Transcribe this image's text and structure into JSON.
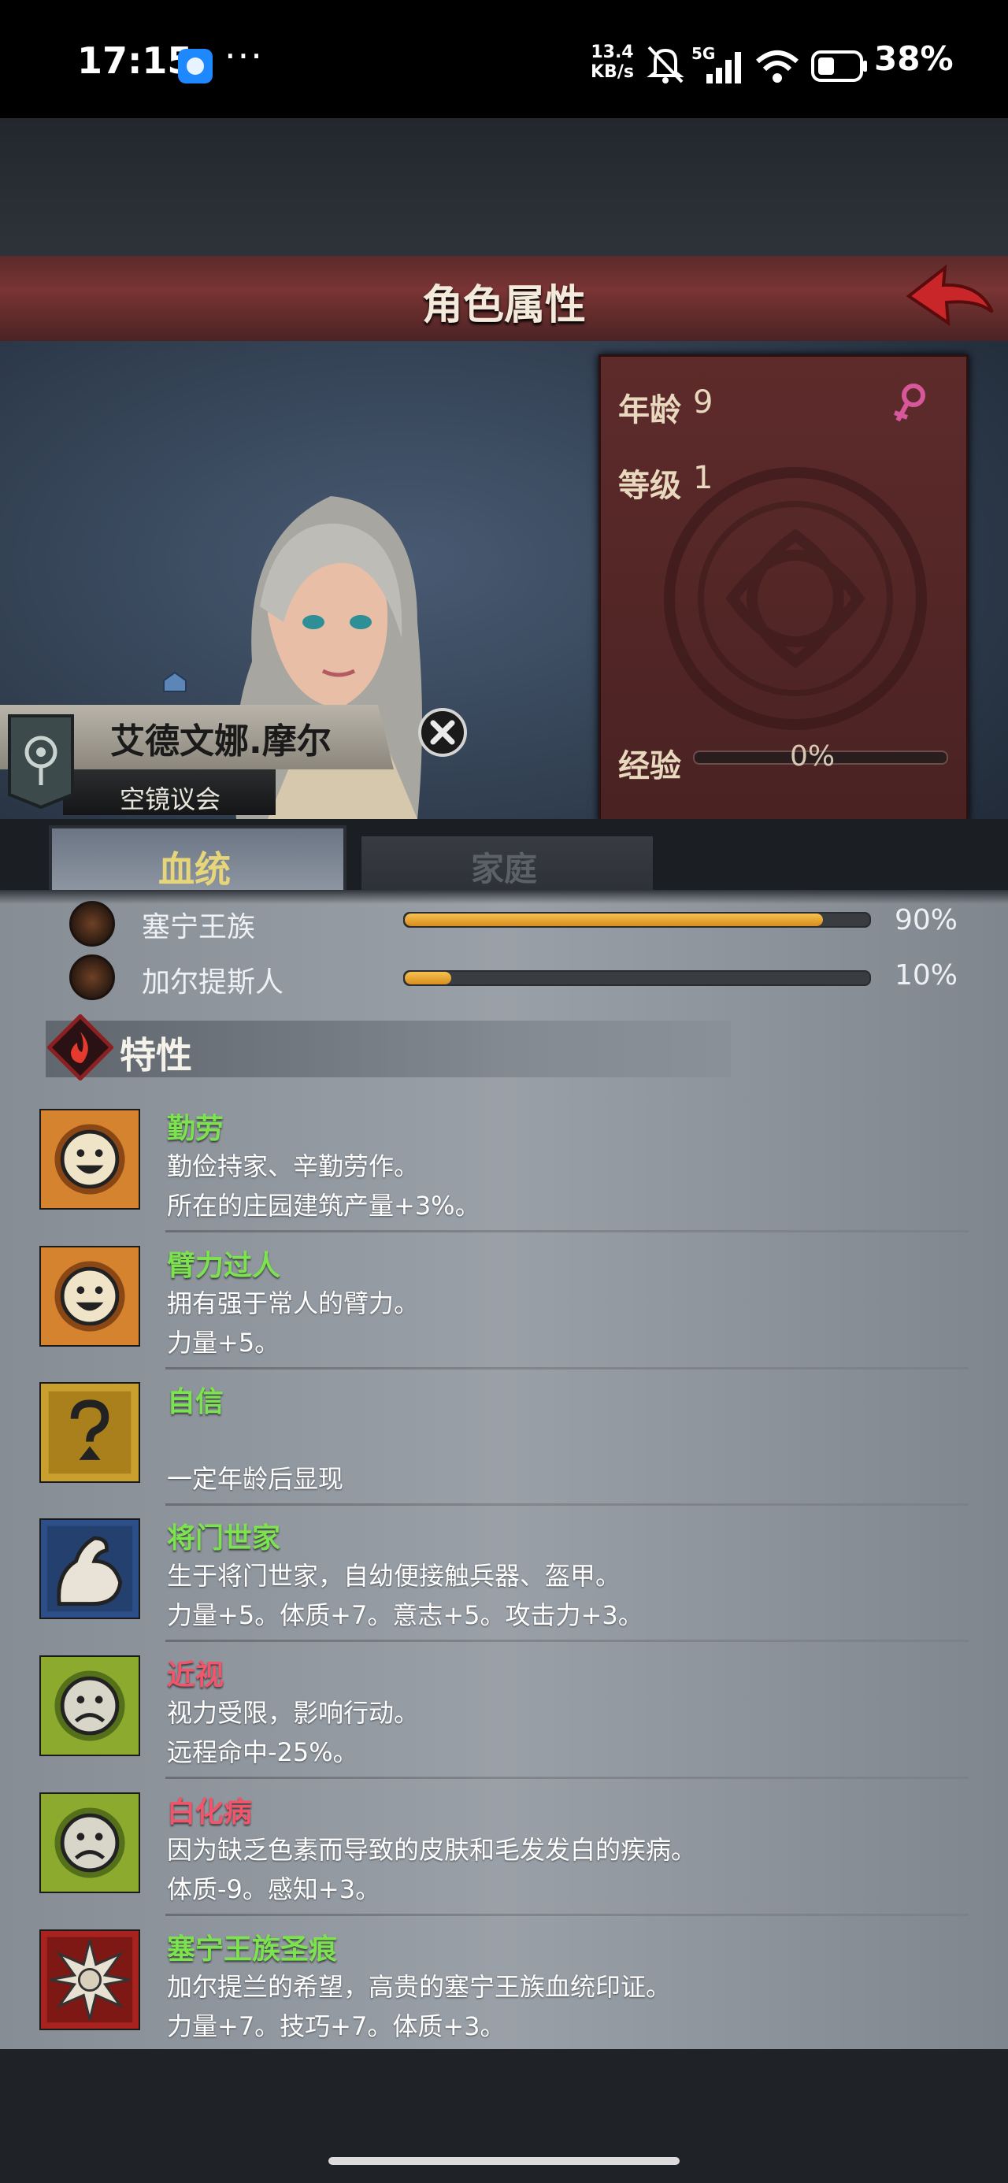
{
  "status_bar": {
    "time": "17:15",
    "dots": "···",
    "net_speed": "13.4",
    "net_unit": "KB/s",
    "network": "5G",
    "battery": "38%"
  },
  "header": {
    "title": "角色属性"
  },
  "character": {
    "name": "艾德文娜.摩尔",
    "organization": "空镜议会",
    "age_label": "年龄",
    "age": "9",
    "level_label": "等级",
    "level": "1",
    "exp_label": "经验",
    "exp_percent": "0%",
    "exp_fraction": 0,
    "gender_color": "#d6589a"
  },
  "tabs": [
    {
      "label": "血统",
      "active": true
    },
    {
      "label": "家庭",
      "active": false
    }
  ],
  "lineage": [
    {
      "name": "塞宁王族",
      "percent": "90%",
      "fraction": 0.9
    },
    {
      "name": "加尔提斯人",
      "percent": "10%",
      "fraction": 0.1
    }
  ],
  "traits_title": "特性",
  "traits": [
    {
      "name": "勤劳",
      "kind": "good",
      "icon": "happy-face-icon",
      "desc": "勤俭持家、辛勤劳作。",
      "effect": "所在的庄园建筑产量+3%。"
    },
    {
      "name": "臂力过人",
      "kind": "good",
      "icon": "happy-face-icon",
      "desc": "拥有强于常人的臂力。",
      "effect": "力量+5。"
    },
    {
      "name": "自信",
      "kind": "good",
      "icon": "question-mark-icon",
      "desc": "",
      "effect": "一定年龄后显现"
    },
    {
      "name": "将门世家",
      "kind": "good",
      "icon": "flexed-arm-icon",
      "desc": "生于将门世家，自幼便接触兵器、盔甲。",
      "effect": "力量+5。体质+7。意志+5。攻击力+3。"
    },
    {
      "name": "近视",
      "kind": "bad",
      "icon": "sad-face-icon",
      "desc": "视力受限，影响行动。",
      "effect": "远程命中-25%。"
    },
    {
      "name": "白化病",
      "kind": "bad",
      "icon": "sad-face-icon",
      "desc": "因为缺乏色素而导致的皮肤和毛发发白的疾病。",
      "effect": "体质-9。感知+3。"
    },
    {
      "name": "塞宁王族圣痕",
      "kind": "good",
      "icon": "holy-mark-icon",
      "desc": "加尔提兰的希望，高贵的塞宁王族血统印证。",
      "effect": "力量+7。技巧+7。体质+3。"
    }
  ]
}
